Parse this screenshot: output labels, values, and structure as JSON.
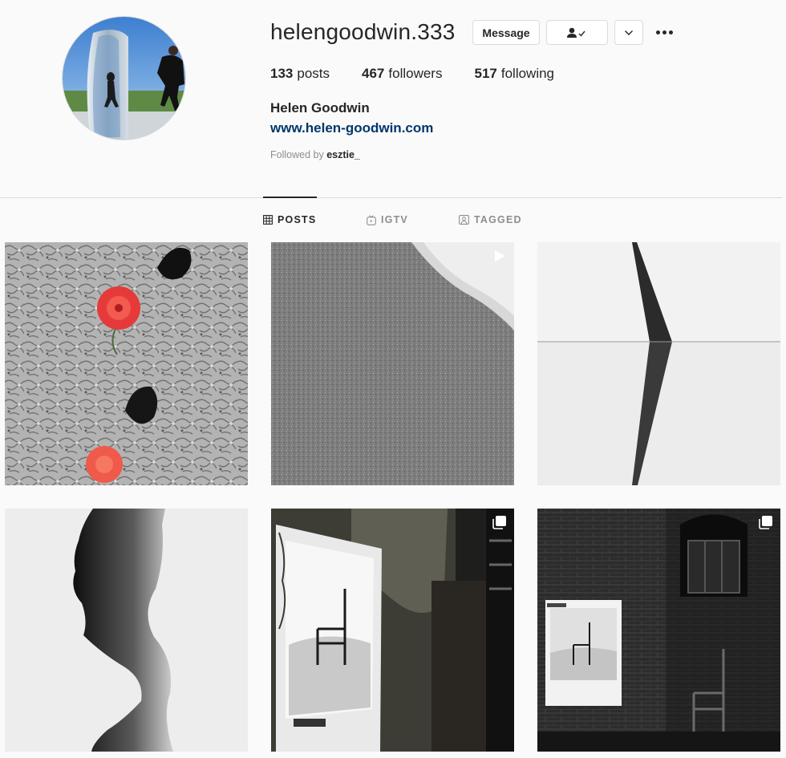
{
  "profile": {
    "username": "helengoodwin.333",
    "full_name": "Helen Goodwin",
    "website": "www.helen-goodwin.com",
    "followed_by_prefix": "Followed by",
    "followed_by_user": "esztie_"
  },
  "buttons": {
    "message_label": "Message"
  },
  "stats": {
    "posts_count": "133",
    "posts_label": "posts",
    "followers_count": "467",
    "followers_label": "followers",
    "following_count": "517",
    "following_label": "following"
  },
  "tabs": [
    {
      "label": "POSTS",
      "icon": "grid-icon",
      "active": true
    },
    {
      "label": "IGTV",
      "icon": "igtv-icon",
      "active": false
    },
    {
      "label": "TAGGED",
      "icon": "tagged-icon",
      "active": false
    }
  ],
  "posts": [
    {
      "badge": "none",
      "subject": "cracked-concrete-flowers"
    },
    {
      "badge": "video-icon",
      "subject": "sand-and-surf"
    },
    {
      "badge": "none",
      "subject": "blade-reflection"
    },
    {
      "badge": "none",
      "subject": "ink-silhouette"
    },
    {
      "badge": "carousel-icon",
      "subject": "billboard-chair"
    },
    {
      "badge": "carousel-icon",
      "subject": "brick-wall-poster-chair"
    }
  ],
  "colors": {
    "background": "#fafafa",
    "text": "#262626",
    "muted": "#8e8e8e",
    "link": "#00376b",
    "border": "#dbdbdb"
  }
}
